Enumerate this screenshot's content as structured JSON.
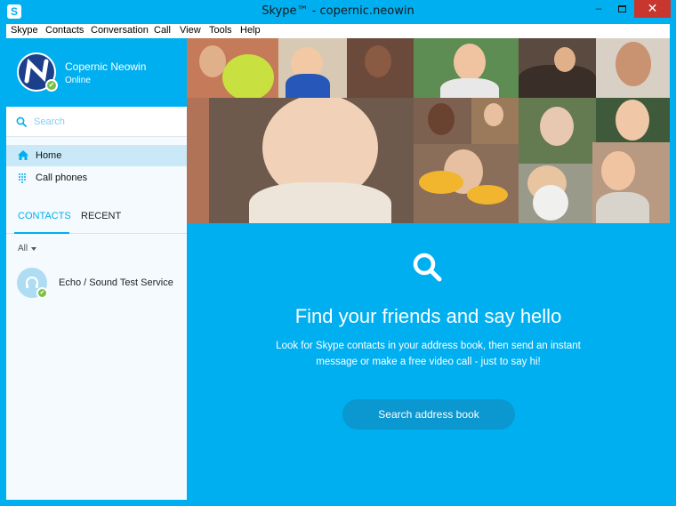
{
  "window": {
    "app_icon": "S",
    "title": "Skype™ - copernic.neowin",
    "min_glyph": "–",
    "close_glyph": "✕"
  },
  "menu": [
    "Skype",
    "Contacts",
    "Conversation",
    "Call",
    "View",
    "Tools",
    "Help"
  ],
  "profile": {
    "name": "Copernic Neowin",
    "status": "Online",
    "status_color": "#7ac142"
  },
  "search": {
    "placeholder": "Search"
  },
  "nav": [
    {
      "label": "Home",
      "icon": "home-icon"
    },
    {
      "label": "Call phones",
      "icon": "dialpad-icon"
    }
  ],
  "tabs": {
    "contacts": "CONTACTS",
    "recent": "RECENT"
  },
  "filter": {
    "label": "All"
  },
  "contacts": [
    {
      "name": "Echo / Sound Test Service",
      "status": "online"
    }
  ],
  "main": {
    "headline": "Find your friends and say hello",
    "subtext": "Look for Skype contacts in your address book, then send an instant message or make a free video call - just to say hi!",
    "cta": "Search address book"
  },
  "colors": {
    "accent": "#00aff0",
    "sidebar_bg": "#f4fafd",
    "selected_nav": "#c9e9f8",
    "cta_bg": "#0b97cf",
    "close_button": "#c7362f"
  }
}
